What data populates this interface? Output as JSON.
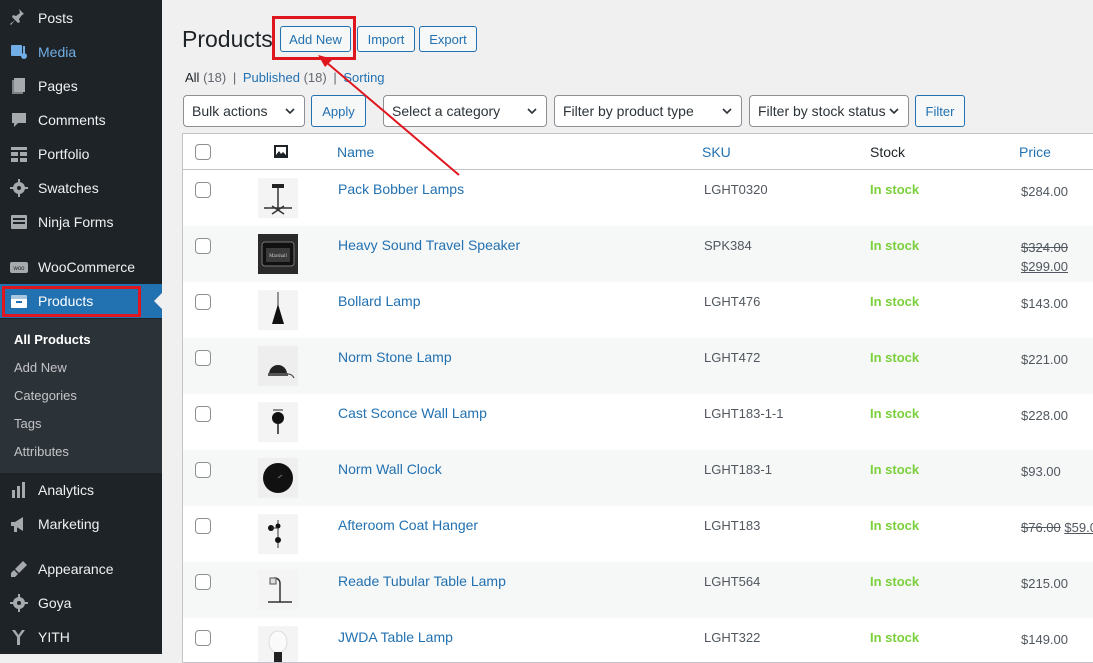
{
  "sidebar": {
    "items": [
      {
        "label": "Posts",
        "icon": "pin-icon"
      },
      {
        "label": "Media",
        "icon": "media-icon"
      },
      {
        "label": "Pages",
        "icon": "pages-icon"
      },
      {
        "label": "Comments",
        "icon": "comments-icon"
      },
      {
        "label": "Portfolio",
        "icon": "portfolio-icon"
      },
      {
        "label": "Swatches",
        "icon": "gear-icon"
      },
      {
        "label": "Ninja Forms",
        "icon": "forms-icon"
      },
      {
        "label": "WooCommerce",
        "icon": "woo-icon"
      },
      {
        "label": "Products",
        "icon": "archive-icon"
      },
      {
        "label": "Analytics",
        "icon": "bar-chart-icon"
      },
      {
        "label": "Marketing",
        "icon": "megaphone-icon"
      },
      {
        "label": "Appearance",
        "icon": "brush-icon"
      },
      {
        "label": "Goya",
        "icon": "gear-icon"
      },
      {
        "label": "YITH",
        "icon": "yith-icon"
      }
    ],
    "submenu": [
      "All Products",
      "Add New",
      "Categories",
      "Tags",
      "Attributes"
    ]
  },
  "header": {
    "title": "Products",
    "add_new": "Add New",
    "import": "Import",
    "export": "Export"
  },
  "views": {
    "all": "All",
    "all_count": "(18)",
    "published": "Published",
    "published_count": "(18)",
    "sorting": "Sorting",
    "sep": "|"
  },
  "filters": {
    "bulk": "Bulk actions",
    "apply": "Apply",
    "category": "Select a category",
    "type": "Filter by product type",
    "stock": "Filter by stock status",
    "filter": "Filter"
  },
  "table": {
    "columns": {
      "name": "Name",
      "sku": "SKU",
      "stock": "Stock",
      "price": "Price"
    },
    "rows": [
      {
        "name": "Pack Bobber Lamps",
        "sku": "LGHT0320",
        "stock": "In stock",
        "price": "$284.00"
      },
      {
        "name": "Heavy Sound Travel Speaker",
        "sku": "SPK384",
        "stock": "In stock",
        "price_old": "$324.00",
        "price_new": "$299.00"
      },
      {
        "name": "Bollard Lamp",
        "sku": "LGHT476",
        "stock": "In stock",
        "price": "$143.00"
      },
      {
        "name": "Norm Stone Lamp",
        "sku": "LGHT472",
        "stock": "In stock",
        "price": "$221.00"
      },
      {
        "name": "Cast Sconce Wall Lamp",
        "sku": "LGHT183-1-1",
        "stock": "In stock",
        "price": "$228.00"
      },
      {
        "name": "Norm Wall Clock",
        "sku": "LGHT183-1",
        "stock": "In stock",
        "price": "$93.00"
      },
      {
        "name": "Afteroom Coat Hanger",
        "sku": "LGHT183",
        "stock": "In stock",
        "price_old": "$76.00",
        "price_new": "$59.0"
      },
      {
        "name": "Reade Tubular Table Lamp",
        "sku": "LGHT564",
        "stock": "In stock",
        "price": "$215.00"
      },
      {
        "name": "JWDA Table Lamp",
        "sku": "LGHT322",
        "stock": "In stock",
        "price": "$149.00"
      }
    ]
  },
  "colors": {
    "accent": "#2271b1",
    "highlight": "#e0161f",
    "in_stock": "#7ad03a",
    "sidebar_bg": "#1d2327"
  }
}
